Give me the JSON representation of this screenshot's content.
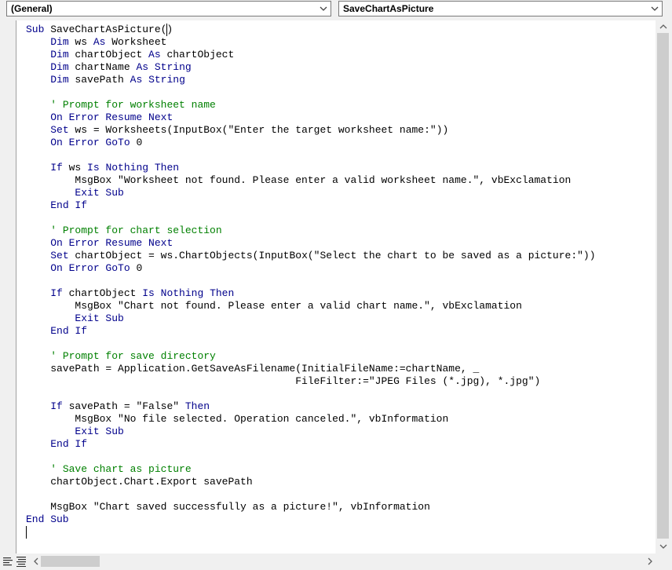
{
  "object_combo": {
    "value": "(General)",
    "icon": "chevron-down-icon"
  },
  "procedure_combo": {
    "value": "SaveChartAsPicture",
    "icon": "chevron-down-icon"
  },
  "code_lines": [
    [
      [
        "k",
        "Sub"
      ],
      [
        "t",
        " SaveChartAsPicture()"
      ]
    ],
    [
      [
        "t",
        "    "
      ],
      [
        "k",
        "Dim"
      ],
      [
        "t",
        " ws "
      ],
      [
        "k",
        "As"
      ],
      [
        "t",
        " Worksheet"
      ]
    ],
    [
      [
        "t",
        "    "
      ],
      [
        "k",
        "Dim"
      ],
      [
        "t",
        " chartObject "
      ],
      [
        "k",
        "As"
      ],
      [
        "t",
        " chartObject"
      ]
    ],
    [
      [
        "t",
        "    "
      ],
      [
        "k",
        "Dim"
      ],
      [
        "t",
        " chartName "
      ],
      [
        "k",
        "As"
      ],
      [
        "t",
        " "
      ],
      [
        "k",
        "String"
      ]
    ],
    [
      [
        "t",
        "    "
      ],
      [
        "k",
        "Dim"
      ],
      [
        "t",
        " savePath "
      ],
      [
        "k",
        "As"
      ],
      [
        "t",
        " "
      ],
      [
        "k",
        "String"
      ]
    ],
    [],
    [
      [
        "t",
        "    "
      ],
      [
        "c",
        "' Prompt for worksheet name"
      ]
    ],
    [
      [
        "t",
        "    "
      ],
      [
        "k",
        "On Error Resume Next"
      ]
    ],
    [
      [
        "t",
        "    "
      ],
      [
        "k",
        "Set"
      ],
      [
        "t",
        " ws = Worksheets(InputBox(\"Enter the target worksheet name:\"))"
      ]
    ],
    [
      [
        "t",
        "    "
      ],
      [
        "k",
        "On Error GoTo"
      ],
      [
        "t",
        " 0"
      ]
    ],
    [],
    [
      [
        "t",
        "    "
      ],
      [
        "k",
        "If"
      ],
      [
        "t",
        " ws "
      ],
      [
        "k",
        "Is Nothing Then"
      ]
    ],
    [
      [
        "t",
        "        MsgBox \"Worksheet not found. Please enter a valid worksheet name.\", vbExclamation"
      ]
    ],
    [
      [
        "t",
        "        "
      ],
      [
        "k",
        "Exit Sub"
      ]
    ],
    [
      [
        "t",
        "    "
      ],
      [
        "k",
        "End If"
      ]
    ],
    [],
    [
      [
        "t",
        "    "
      ],
      [
        "c",
        "' Prompt for chart selection"
      ]
    ],
    [
      [
        "t",
        "    "
      ],
      [
        "k",
        "On Error Resume Next"
      ]
    ],
    [
      [
        "t",
        "    "
      ],
      [
        "k",
        "Set"
      ],
      [
        "t",
        " chartObject = ws.ChartObjects(InputBox(\"Select the chart to be saved as a picture:\"))"
      ]
    ],
    [
      [
        "t",
        "    "
      ],
      [
        "k",
        "On Error GoTo"
      ],
      [
        "t",
        " 0"
      ]
    ],
    [],
    [
      [
        "t",
        "    "
      ],
      [
        "k",
        "If"
      ],
      [
        "t",
        " chartObject "
      ],
      [
        "k",
        "Is Nothing Then"
      ]
    ],
    [
      [
        "t",
        "        MsgBox \"Chart not found. Please enter a valid chart name.\", vbExclamation"
      ]
    ],
    [
      [
        "t",
        "        "
      ],
      [
        "k",
        "Exit Sub"
      ]
    ],
    [
      [
        "t",
        "    "
      ],
      [
        "k",
        "End If"
      ]
    ],
    [],
    [
      [
        "t",
        "    "
      ],
      [
        "c",
        "' Prompt for save directory"
      ]
    ],
    [
      [
        "t",
        "    savePath = Application.GetSaveAsFilename(InitialFileName:=chartName, _"
      ]
    ],
    [
      [
        "t",
        "                                            FileFilter:=\"JPEG Files (*.jpg), *.jpg\")"
      ]
    ],
    [],
    [
      [
        "t",
        "    "
      ],
      [
        "k",
        "If"
      ],
      [
        "t",
        " savePath = \"False\" "
      ],
      [
        "k",
        "Then"
      ]
    ],
    [
      [
        "t",
        "        MsgBox \"No file selected. Operation canceled.\", vbInformation"
      ]
    ],
    [
      [
        "t",
        "        "
      ],
      [
        "k",
        "Exit Sub"
      ]
    ],
    [
      [
        "t",
        "    "
      ],
      [
        "k",
        "End If"
      ]
    ],
    [],
    [
      [
        "t",
        "    "
      ],
      [
        "c",
        "' Save chart as picture"
      ]
    ],
    [
      [
        "t",
        "    chartObject.Chart.Export savePath"
      ]
    ],
    [],
    [
      [
        "t",
        "    MsgBox \"Chart saved successfully as a picture!\", vbInformation"
      ]
    ],
    [
      [
        "k",
        "End Sub"
      ]
    ],
    []
  ],
  "colors": {
    "keyword": "#00008b",
    "comment": "#008000",
    "text": "#000000",
    "scroll_thumb": "#cdcdcd"
  },
  "icons": {
    "procedure_view": "procedure-view-icon",
    "module_view": "full-module-view-icon",
    "scroll_up": "arrow-up-icon",
    "scroll_down": "arrow-down-icon",
    "scroll_left": "arrow-left-icon",
    "scroll_right": "arrow-right-icon"
  }
}
